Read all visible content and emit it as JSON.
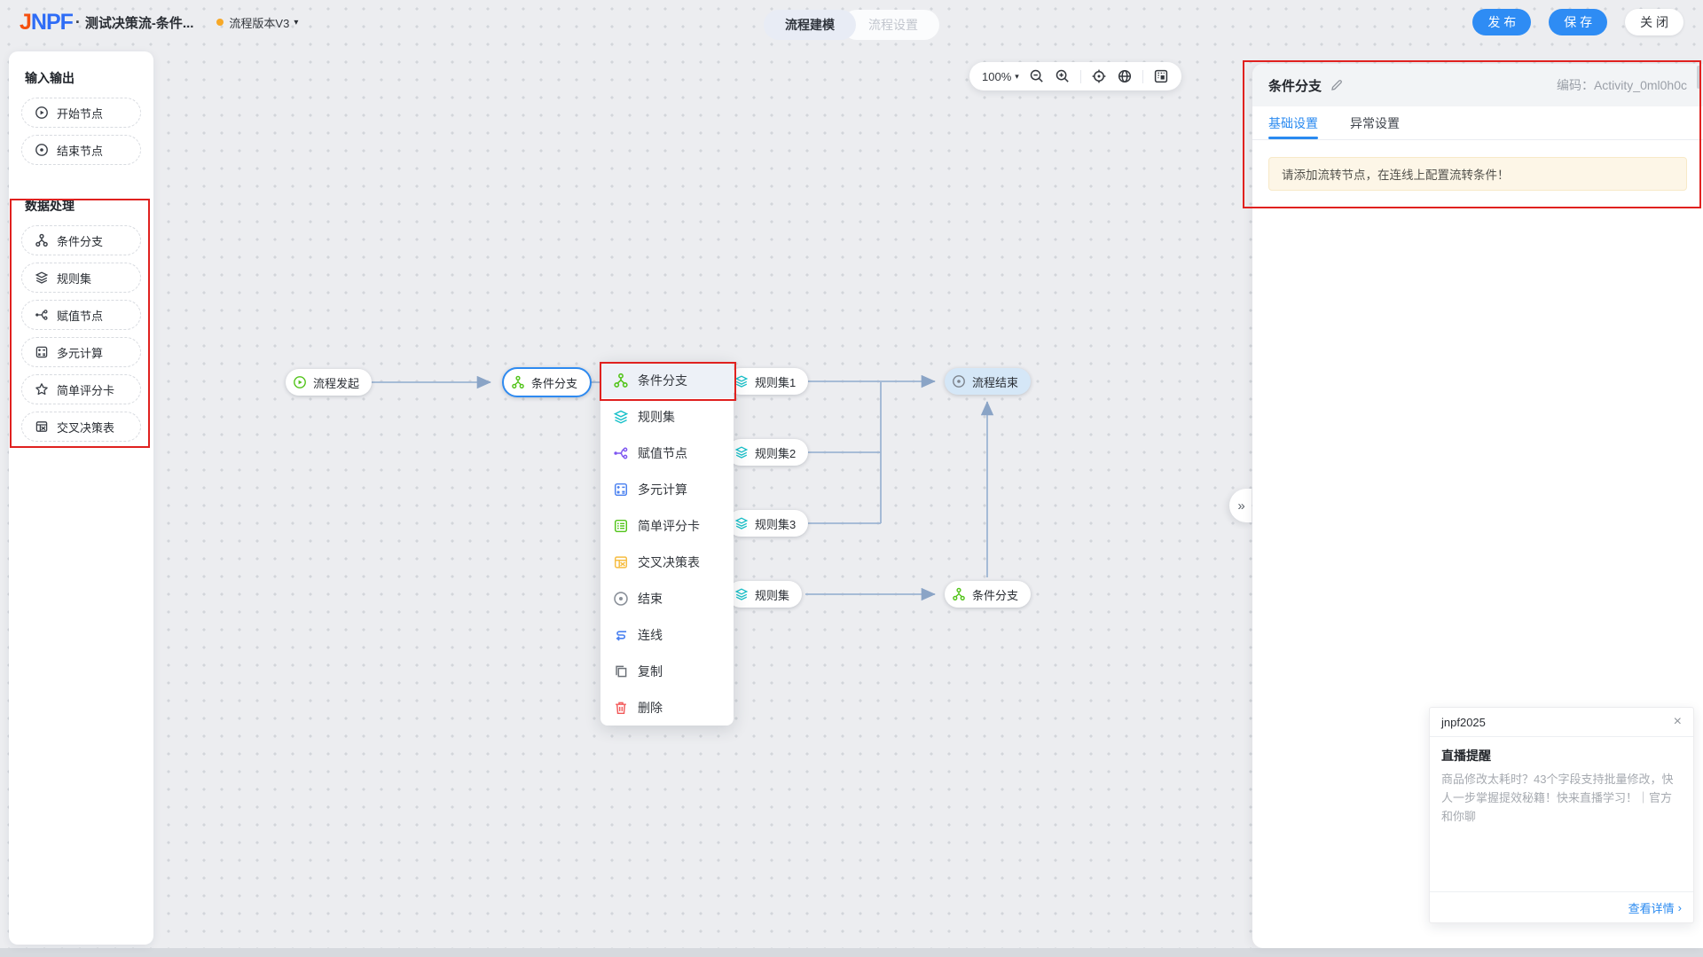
{
  "topbar": {
    "logo_j": "J",
    "logo_npf": "NPF",
    "logo_sep": "·",
    "title": "测试决策流-条件...",
    "version_label": "流程版本V3",
    "version_caret": "▾",
    "tabs": [
      {
        "label": "流程建模",
        "active": true
      },
      {
        "label": "流程设置",
        "active": false
      }
    ],
    "buttons": {
      "publish": "发 布",
      "save": "保 存",
      "close": "关 闭"
    }
  },
  "sidebar": {
    "sections": [
      {
        "title": "输入输出",
        "items": [
          {
            "label": "开始节点",
            "icon": "play-circle-icon"
          },
          {
            "label": "结束节点",
            "icon": "end-circle-icon"
          }
        ]
      },
      {
        "title": "数据处理",
        "items": [
          {
            "label": "条件分支",
            "icon": "branch-icon"
          },
          {
            "label": "规则集",
            "icon": "layers-icon"
          },
          {
            "label": "赋值节点",
            "icon": "assign-icon"
          },
          {
            "label": "多元计算",
            "icon": "calc-icon"
          },
          {
            "label": "简单评分卡",
            "icon": "star-icon"
          },
          {
            "label": "交叉决策表",
            "icon": "cross-table-icon"
          }
        ]
      }
    ]
  },
  "toolbar": {
    "zoom_level": "100%",
    "caret": "▾",
    "icons": [
      "zoom-out-icon",
      "zoom-in-icon",
      "center-target-icon",
      "globe-icon",
      "minimap-icon"
    ]
  },
  "canvas": {
    "nodes": [
      {
        "id": "start",
        "label": "流程发起",
        "icon": "play-circle-icon",
        "color": "#52c41a"
      },
      {
        "id": "branch-selected",
        "label": "条件分支",
        "icon": "branch-icon",
        "color": "#52c41a",
        "selected": true
      },
      {
        "id": "ruleset1",
        "label": "规则集1",
        "icon": "layers-icon",
        "color": "#17c0c9"
      },
      {
        "id": "ruleset2",
        "label": "规则集2",
        "icon": "layers-icon",
        "color": "#17c0c9"
      },
      {
        "id": "ruleset3",
        "label": "规则集3",
        "icon": "layers-icon",
        "color": "#17c0c9"
      },
      {
        "id": "ruleset4",
        "label": "规则集",
        "icon": "layers-icon",
        "color": "#17c0c9"
      },
      {
        "id": "end",
        "label": "流程结束",
        "icon": "end-circle-icon",
        "color": "#7d838c",
        "highlighted": true
      },
      {
        "id": "branch2",
        "label": "条件分支",
        "icon": "branch-icon",
        "color": "#52c41a"
      }
    ],
    "edge_color": "#9db5d3"
  },
  "context_menu": {
    "items": [
      {
        "label": "条件分支",
        "icon": "branch-icon",
        "color": "#52c41a",
        "highlighted": true
      },
      {
        "label": "规则集",
        "icon": "layers-icon",
        "color": "#17c0c9"
      },
      {
        "label": "赋值节点",
        "icon": "assign-icon",
        "color": "#7d55f0"
      },
      {
        "label": "多元计算",
        "icon": "calc-icon",
        "color": "#4980f0"
      },
      {
        "label": "简单评分卡",
        "icon": "scorecard-icon",
        "color": "#52c41a"
      },
      {
        "label": "交叉决策表",
        "icon": "cross-table-icon",
        "color": "#f6bd42"
      },
      {
        "label": "结束",
        "icon": "end-circle-icon",
        "color": "#8a9099"
      },
      {
        "label": "连线",
        "icon": "connect-icon",
        "color": "#4980f0"
      },
      {
        "label": "复制",
        "icon": "copy-icon",
        "color": "#6b7077"
      },
      {
        "label": "删除",
        "icon": "delete-icon",
        "color": "#f25a5a"
      }
    ]
  },
  "collapse_glyph": "»",
  "panel": {
    "title": "条件分支",
    "code_label": "编码：",
    "code_value": "Activity_0ml0h0c",
    "tabs": [
      {
        "label": "基础设置",
        "active": true
      },
      {
        "label": "异常设置",
        "active": false
      }
    ],
    "warning": "请添加流转节点，在连线上配置流转条件！"
  },
  "popup": {
    "header": "jnpf2025",
    "close_glyph": "×",
    "title": "直播提醒",
    "body": "商品修改太耗时？43个字段支持批量修改，快人一步掌握提效秘籍！快来直播学习！｜官方和你聊",
    "link": "查看详情",
    "link_chevron": "›"
  },
  "colors": {
    "accent_blue": "#2e8cf4",
    "annotation_red": "#e0211f",
    "selected_node_border": "#2e8af0",
    "end_node_bg": "#d5e7f7",
    "warning_bg": "#fdf6e7",
    "warning_border": "#f7e9c8",
    "edge": "#9db5d3",
    "canvas_bg": "#ecedf0",
    "logo_orange": "#f5500f",
    "logo_blue": "#2e6cf6",
    "version_dot": "#f7a827"
  }
}
